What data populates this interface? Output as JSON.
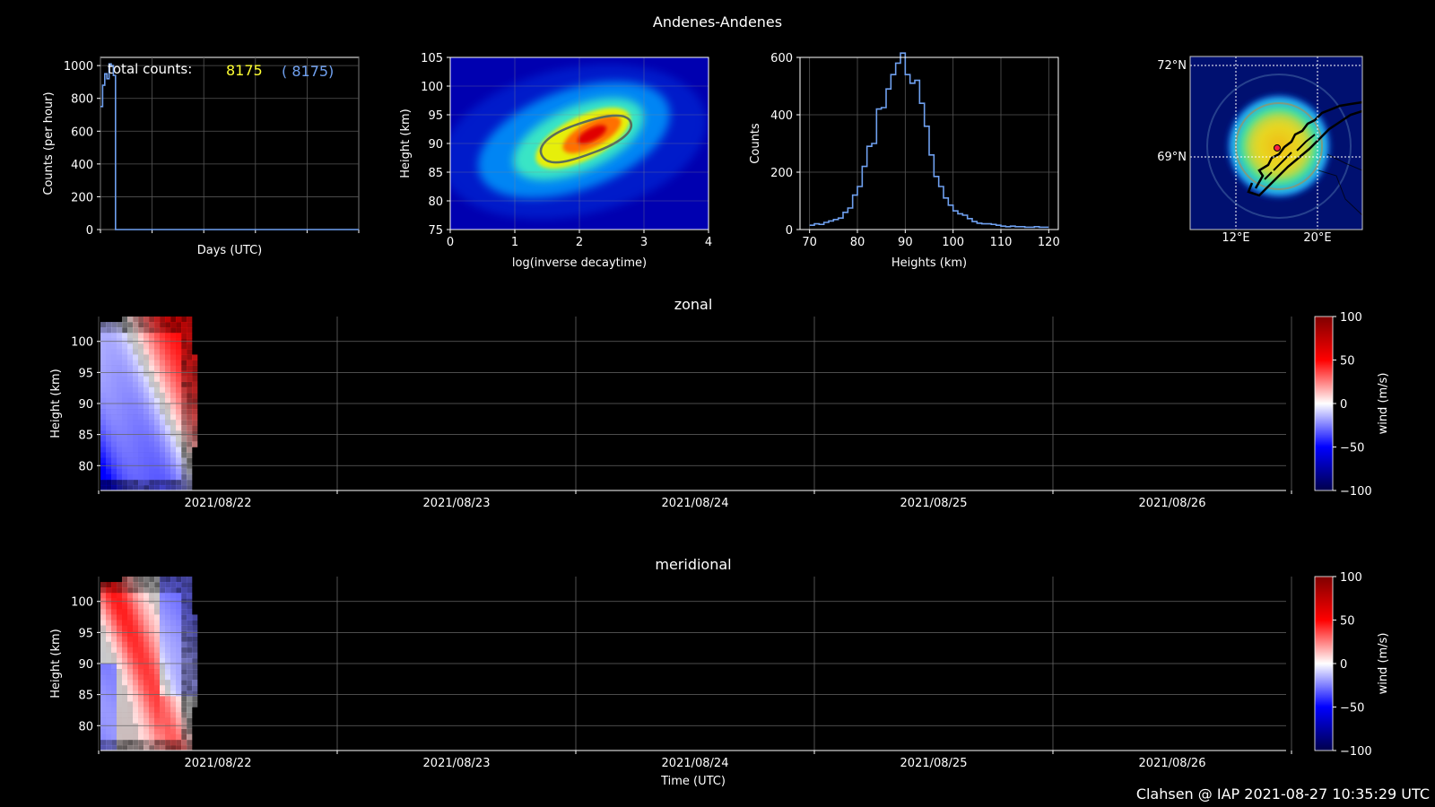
{
  "figure": {
    "title": "Andenes-Andenes",
    "footer": "Clahsen @ IAP 2021-08-27 10:35:29 UTC"
  },
  "colors": {
    "background": "#000000",
    "line": "#6fa0ef",
    "total_counts_value": "#ffff33",
    "total_counts_paren": "#6fa0ef",
    "contour": "#5a6e5a"
  },
  "chart_data": [
    {
      "id": "counts_per_hour",
      "type": "line",
      "title": "",
      "xlabel": "Days (UTC)",
      "ylabel": "Counts (per hour)",
      "ylim": [
        0,
        1050
      ],
      "yticks": [
        0,
        200,
        400,
        600,
        800,
        1000
      ],
      "xlim_hours": [
        0,
        120
      ],
      "x_hours": [
        0,
        1,
        2,
        3,
        4,
        5,
        6,
        7,
        8,
        9,
        120
      ],
      "values": [
        750,
        880,
        950,
        920,
        1010,
        1000,
        940,
        0,
        0,
        0,
        0
      ],
      "annotation": {
        "label": "total counts:",
        "value": "8175",
        "paren": "(  8175)"
      },
      "grid": true
    },
    {
      "id": "height_vs_decaytime",
      "type": "heatmap",
      "title": "",
      "xlabel": "log(inverse decaytime)",
      "ylabel": "Height (km)",
      "xlim": [
        0,
        4
      ],
      "ylim": [
        75,
        105
      ],
      "xticks": [
        0,
        1,
        2,
        3,
        4
      ],
      "yticks": [
        75,
        80,
        85,
        90,
        95,
        100,
        105
      ],
      "peak": {
        "x": 2.2,
        "y": 91
      },
      "grid": true
    },
    {
      "id": "height_histogram",
      "type": "bar",
      "title": "",
      "xlabel": "Heights (km)",
      "ylabel": "Counts",
      "xlim": [
        68,
        122
      ],
      "ylim": [
        0,
        600
      ],
      "xticks": [
        70,
        80,
        90,
        100,
        110,
        120
      ],
      "yticks": [
        0,
        200,
        400,
        600
      ],
      "bin_width": 1,
      "x": [
        70,
        71,
        72,
        73,
        74,
        75,
        76,
        77,
        78,
        79,
        80,
        81,
        82,
        83,
        84,
        85,
        86,
        87,
        88,
        89,
        90,
        91,
        92,
        93,
        94,
        95,
        96,
        97,
        98,
        99,
        100,
        101,
        102,
        103,
        104,
        105,
        106,
        107,
        108,
        109,
        110,
        111,
        112,
        113,
        114,
        115,
        116,
        117,
        118,
        119
      ],
      "values": [
        15,
        20,
        18,
        25,
        30,
        35,
        40,
        60,
        75,
        120,
        150,
        220,
        290,
        300,
        420,
        425,
        490,
        540,
        580,
        615,
        540,
        510,
        520,
        440,
        360,
        260,
        185,
        150,
        110,
        85,
        65,
        55,
        50,
        38,
        28,
        22,
        20,
        20,
        18,
        15,
        12,
        10,
        12,
        10,
        10,
        8,
        8,
        10,
        8,
        8
      ],
      "grid": true
    },
    {
      "id": "location_map",
      "type": "heatmap",
      "title": "",
      "lat_labels": [
        "72°N",
        "69°N"
      ],
      "lon_labels": [
        "12°E",
        "20°E"
      ],
      "station": {
        "lat": 69.3,
        "lon": 16.0
      }
    },
    {
      "id": "zonal_wind",
      "type": "heatmap",
      "title": "zonal",
      "xlabel": "",
      "ylabel": "Height (km)",
      "ylim": [
        76,
        104
      ],
      "yticks": [
        80,
        85,
        90,
        95,
        100
      ],
      "x_dates": [
        "2021/08/22",
        "2021/08/23",
        "2021/08/24",
        "2021/08/25",
        "2021/08/26"
      ],
      "colorbar": {
        "label": "wind (m/s)",
        "range": [
          -100,
          100
        ],
        "ticks": [
          -100,
          -50,
          0,
          50,
          100
        ]
      },
      "data_time_span": [
        "2021-08-21 19:00",
        "2021-08-22 03:00"
      ],
      "pattern": "upper-right positive, lower-left negative"
    },
    {
      "id": "meridional_wind",
      "type": "heatmap",
      "title": "meridional",
      "xlabel": "Time (UTC)",
      "ylabel": "Height (km)",
      "ylim": [
        76,
        104
      ],
      "yticks": [
        80,
        85,
        90,
        95,
        100
      ],
      "x_dates": [
        "2021/08/22",
        "2021/08/23",
        "2021/08/24",
        "2021/08/25",
        "2021/08/26"
      ],
      "colorbar": {
        "label": "wind (m/s)",
        "range": [
          -100,
          100
        ],
        "ticks": [
          -100,
          -50,
          0,
          50,
          100
        ]
      },
      "data_time_span": [
        "2021-08-21 19:00",
        "2021-08-22 03:00"
      ],
      "pattern": "diagonal positive band, negative on flanks"
    }
  ]
}
